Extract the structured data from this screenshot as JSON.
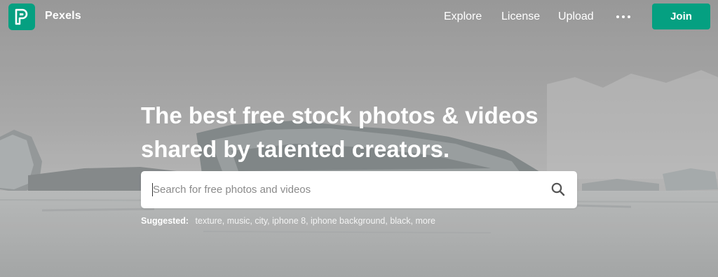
{
  "brand": {
    "name": "Pexels",
    "logo_letter": "P",
    "accent_color": "#05a081"
  },
  "nav": {
    "links": [
      {
        "label": "Explore"
      },
      {
        "label": "License"
      },
      {
        "label": "Upload"
      }
    ],
    "more_icon": "ellipsis-icon",
    "join_label": "Join"
  },
  "hero": {
    "headline_line1": "The best free stock photos & videos",
    "headline_line2": "shared by talented creators."
  },
  "search": {
    "placeholder": "Search for free photos and videos",
    "value": "",
    "icon": "search-icon"
  },
  "suggested": {
    "label": "Suggested:",
    "items": [
      "texture",
      "music",
      "city",
      "iphone 8",
      "iphone background",
      "black",
      "more"
    ]
  }
}
